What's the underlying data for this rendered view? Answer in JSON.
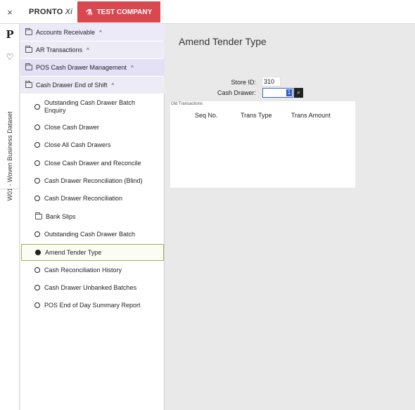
{
  "topbar": {
    "close_glyph": "×",
    "brand": "PRONTO",
    "brand_suffix": "Xi",
    "company": "TEST COMPANY",
    "company_icon": "flask-icon",
    "company_color": "#d9474f"
  },
  "rail": {
    "logo": "P",
    "favorite_icon": "heart-icon",
    "dataset_label": "W01 - Woven Business Dataset"
  },
  "sidebar": {
    "folders": [
      {
        "label": "Accounts Receivable"
      },
      {
        "label": "AR Transactions"
      },
      {
        "label": "POS Cash Drawer Management"
      },
      {
        "label": "Cash Drawer End of Shift"
      }
    ],
    "items": [
      {
        "label": "Outstanding Cash Drawer Batch Enquiry"
      },
      {
        "label": "Close Cash Drawer"
      },
      {
        "label": "Close All Cash Drawers"
      },
      {
        "label": "Close Cash Drawer and Reconcile"
      },
      {
        "label": "Cash Drawer Reconciliation (Blind)"
      },
      {
        "label": "Cash Drawer Reconciliation"
      },
      {
        "label": "Bank Slips"
      },
      {
        "label": "Outstanding Cash Drawer Batch"
      },
      {
        "label": "Amend Tender Type"
      },
      {
        "label": "Cash Reconciliation History"
      },
      {
        "label": "Cash Drawer Unbanked Batches"
      },
      {
        "label": "POS End of Day Summary Report"
      }
    ],
    "active_item": "Amend Tender Type",
    "active_color": "#9fb45a"
  },
  "main": {
    "title": "Amend Tender Type",
    "store_id_label": "Store ID:",
    "store_id_value": "310",
    "cash_drawer_label": "Cash Drawer:",
    "cash_drawer_value": "1",
    "lookup_icon": "search-icon",
    "panel_title": "Old Transactions",
    "columns": [
      "Seq No.",
      "Trans Type",
      "Trans Amount"
    ]
  }
}
